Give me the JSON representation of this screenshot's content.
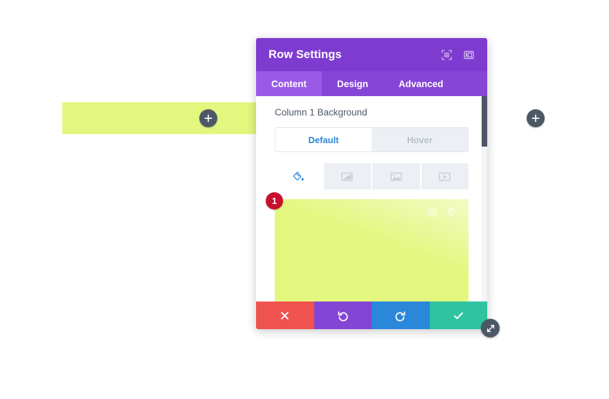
{
  "canvas": {
    "row": {
      "name": "builder-row",
      "background_color": "#e3f77e"
    },
    "add_inline_label": "+",
    "add_right_label": "+"
  },
  "modal": {
    "title": "Row Settings",
    "header_icons": [
      {
        "name": "focus-icon",
        "label": "Focus"
      },
      {
        "name": "layout-columns-icon",
        "label": "Layout"
      }
    ],
    "tabs": [
      {
        "label": "Content",
        "active": true
      },
      {
        "label": "Design",
        "active": false
      },
      {
        "label": "Advanced",
        "active": false
      }
    ],
    "section": {
      "label": "Column 1 Background",
      "state_options": [
        {
          "label": "Default",
          "active": true
        },
        {
          "label": "Hover",
          "active": false
        }
      ],
      "background_types": [
        {
          "name": "background-color-icon",
          "label": "Background Color",
          "active": true
        },
        {
          "name": "background-gradient-icon",
          "label": "Background Gradient",
          "active": false
        },
        {
          "name": "background-image-icon",
          "label": "Background Image",
          "active": false
        },
        {
          "name": "background-video-icon",
          "label": "Background Video",
          "active": false
        }
      ],
      "swatch": {
        "color": "#e3f77e",
        "badge": "1",
        "badge_color": "#c8102e",
        "tools": [
          {
            "name": "color-picker-icon",
            "label": "Pick Color"
          },
          {
            "name": "trash-icon",
            "label": "Delete"
          }
        ]
      }
    },
    "footer_buttons": [
      {
        "name": "close-button",
        "label": "Close",
        "color": "#ef5350"
      },
      {
        "name": "undo-button",
        "label": "Undo",
        "color": "#8345d3"
      },
      {
        "name": "redo-button",
        "label": "Redo",
        "color": "#2b87da"
      },
      {
        "name": "save-button",
        "label": "Save",
        "color": "#2ec4a0"
      }
    ],
    "resize_handle_label": "Resize"
  }
}
